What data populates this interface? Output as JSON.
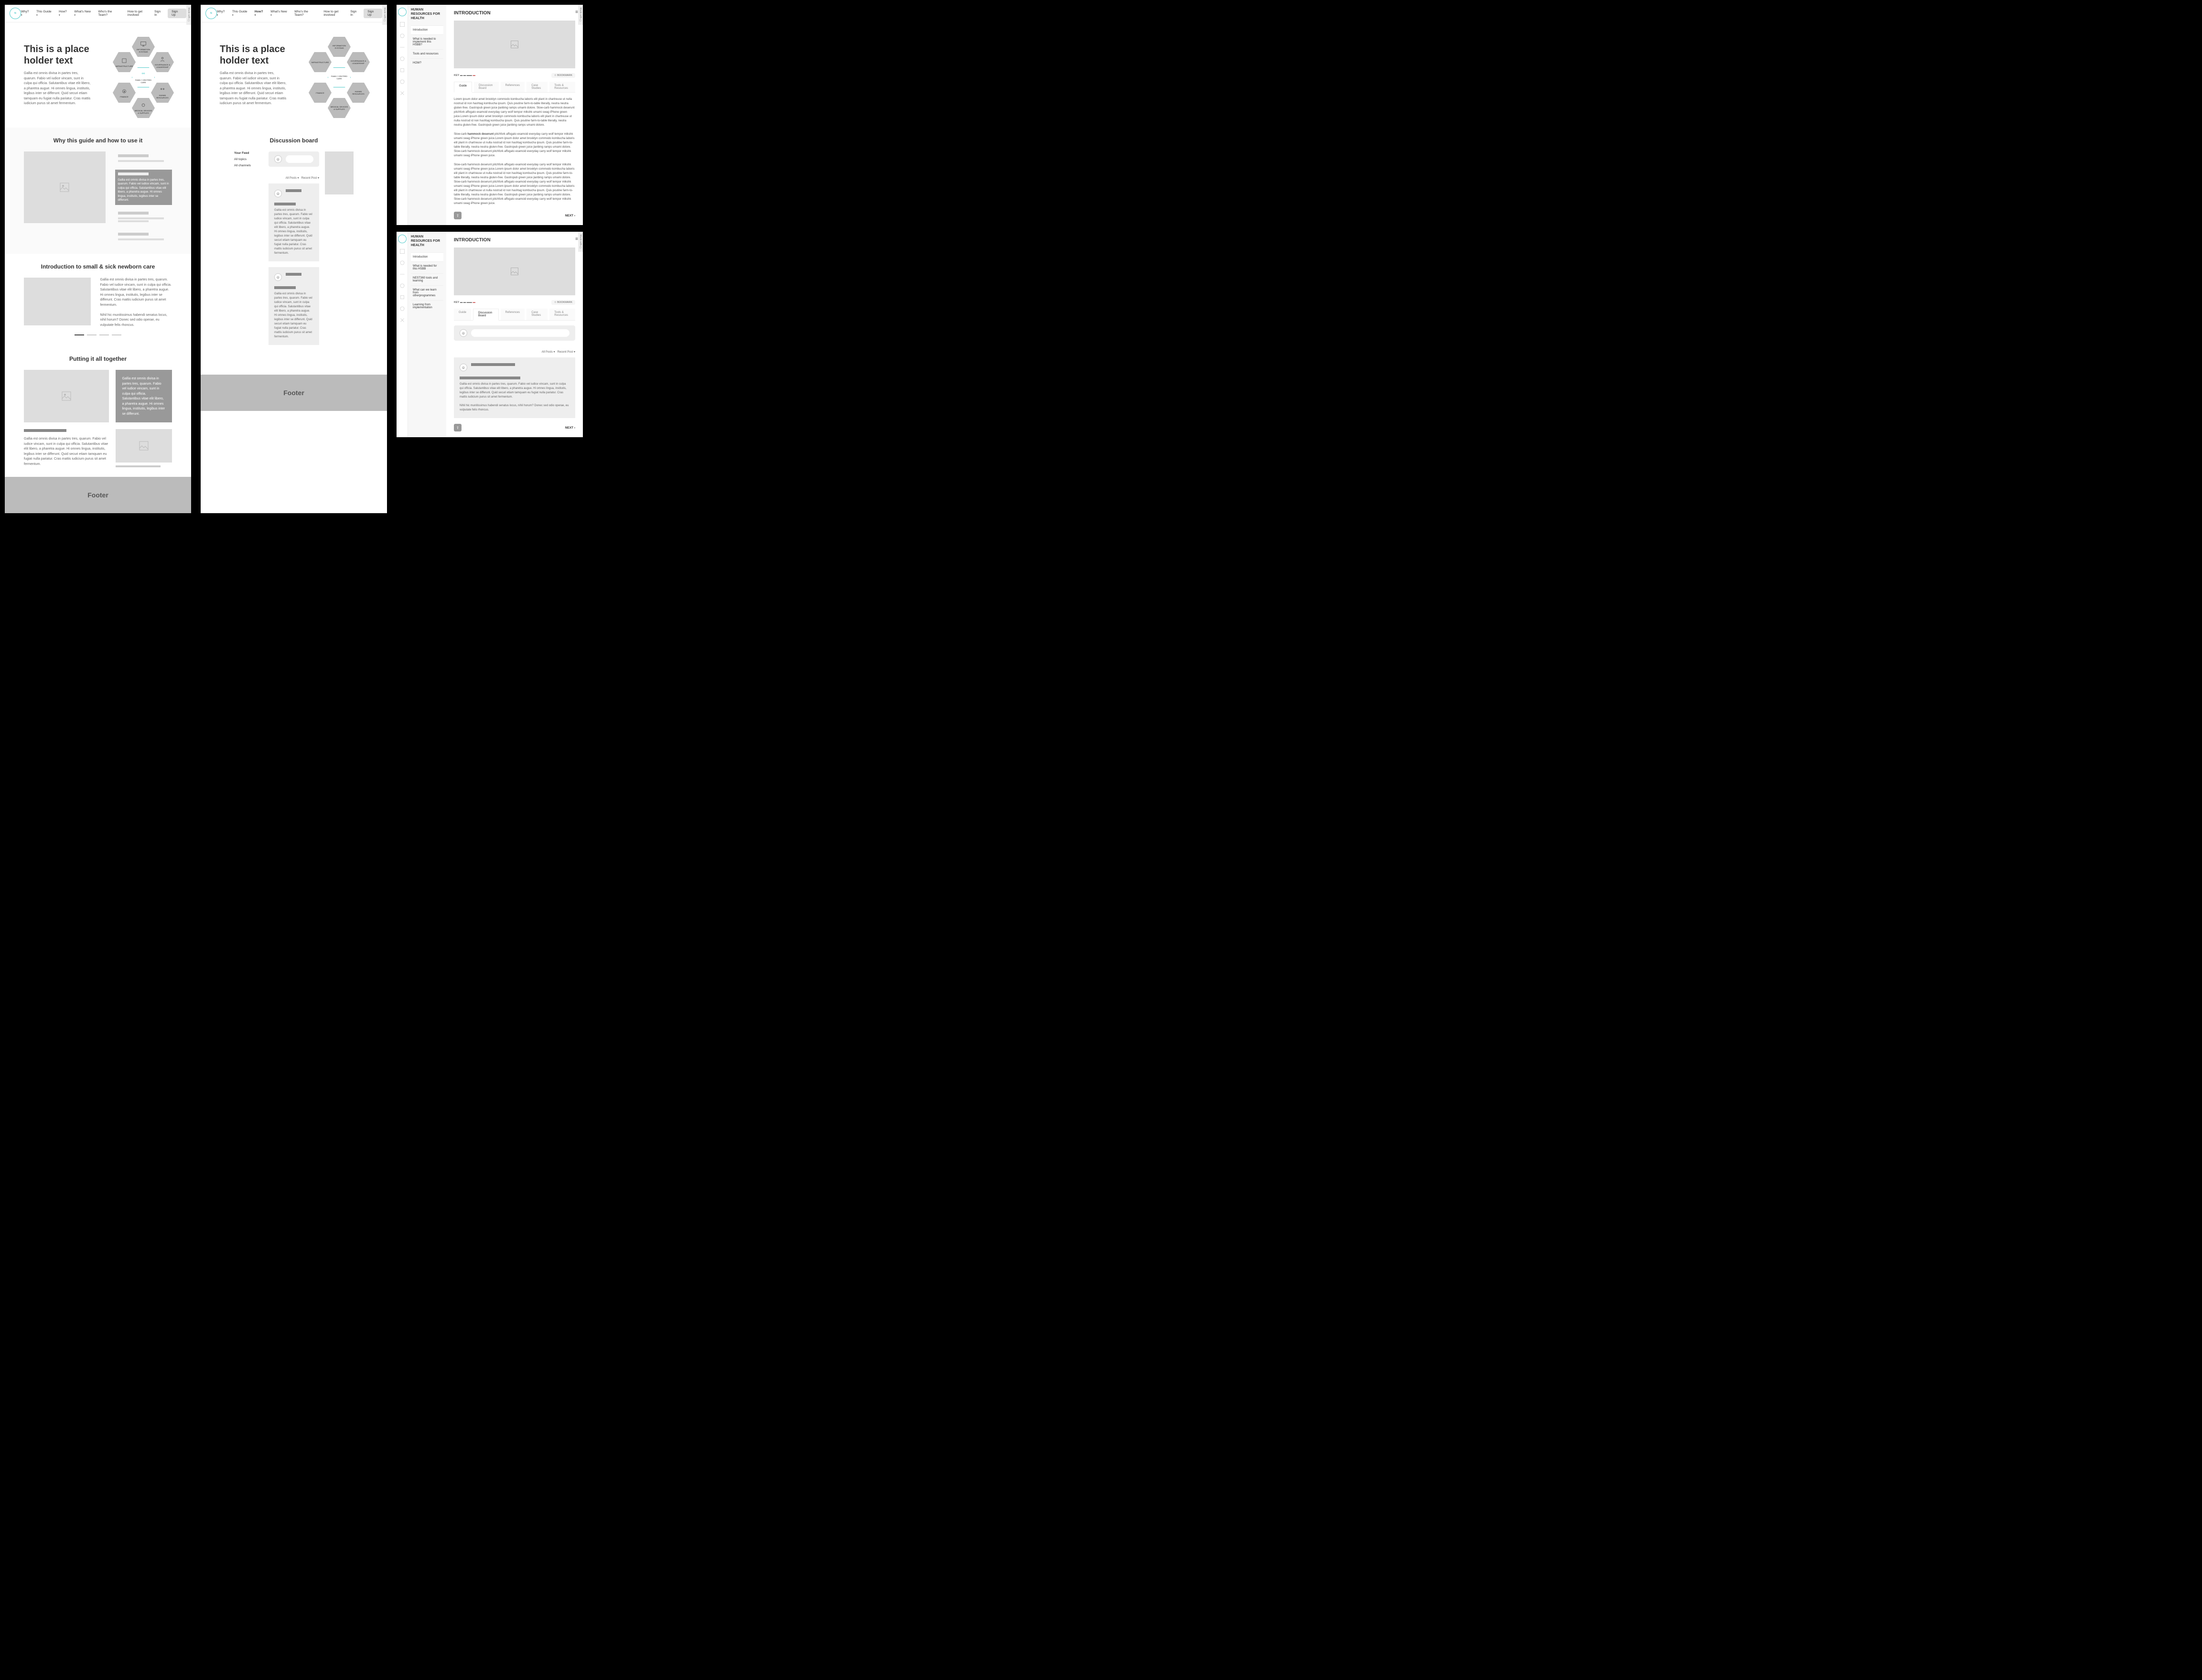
{
  "nav": {
    "items": [
      "Why?",
      "This Guide",
      "How?",
      "What's New",
      "Who's the Team?",
      "How to get involved"
    ],
    "signin": "Sign In",
    "signup": "Sign Up"
  },
  "hero": {
    "title": "This is a place holder text",
    "body": "Gallia est omnis divisa in partes tres, quarum. Fabio vel iudice vincam, sunt in culpa qui officia. Salutantibus vitae elit libero, a pharetra augue. Hi omnes lingua, institutis, legibus inter se differunt. Quid securi etiam tamquam eu fugiat nulla pariatur. Cras mattis iudicium purus sit amet fermentum."
  },
  "hex": {
    "top": "INFORMATION SYSTEMS",
    "tl": "INFRASTRUCTURE",
    "tr": "GOVERNANCE & LEADERSHIP",
    "center": "FAMILY CENTRED CARE",
    "bl": "FINANCE",
    "br": "HUMAN RESOURCES",
    "bottom": "MEDICAL DEVICES & SUPPLIES",
    "ring": "PREVENTION"
  },
  "s2": {
    "title": "Why this guide and how to use it",
    "active_text": "Gallia est omnis divisa in partes tres, quarum. Fabio vel iudice vincam, sunt in culpa qui officia. Salutantibus vitae elit libero, a pharetra augue. Hi omnes lingua, institutis, legibus inter se differunt."
  },
  "s3": {
    "title": "Introduction to small & sick newborn care",
    "p1": "Gallia est omnis divisa in partes tres, quarum. Fabio vel iudice vincam, sunt in culpa qui officia. Salutantibus vitae elit libero, a pharetra augue. Hi omnes lingua, institutis, legibus inter se differunt. Cras mattis iudicium purus sit amet fermentum.",
    "p2": "Nihil hic munitissimus habendi senatus locus, nihil horum? Donec sed odio operae, eu vulputate felis rhoncus."
  },
  "s4": {
    "title": "Putting it all together",
    "card": "Gallia est omnis divisa in partes tres, quarum. Fabio vel iudice vincam, sunt in culpa qui officia. Salutantibus vitae elit libero, a pharetra augue. Hi omnes lingua, institutis, legibus inter se differunt.",
    "para": "Gallia est omnis divisa in partes tres, quarum. Fabio vel iudice vincam, sunt in culpa qui officia. Salutantibus vitae elit libero, a pharetra augue. Hi omnes lingua, institutis, legibus inter se differunt. Quid securi etiam tamquam eu fugiat nulla pariatur. Cras mattis iudicium purus sit amet fermentum."
  },
  "footer": "Footer",
  "disc": {
    "title": "Discussion board",
    "left": {
      "feed": "Your Feed",
      "topics": "All topics",
      "channels": "All channels"
    },
    "sort": {
      "all": "All Posts ▾",
      "recent": "Recent Post ▾"
    },
    "post_body": "Gallia est omnis divisa in partes tres, quarum. Fabio vel iudice vincam, sunt in culpa qui officia. Salutantibus vitae elit libero, a pharetra augue. Hi omnes lingua, institutis, legibus inter se differunt. Quid securi etiam tamquam eu fugiat nulla pariatur. Cras mattis iudicium purus sit amet fermentum."
  },
  "cp": {
    "section": "HUMAN RESOURCES FOR HEALTH",
    "page_title": "INTRODUCTION",
    "sidebar_a": [
      "Introduction",
      "What is needed to implement this HSBB?",
      "Tools and resources",
      "HOW?"
    ],
    "sidebar_b": [
      "Introduction",
      "What is needed for this HSBB",
      "NEST360 tools and learning",
      "What can we learn from otherprogrammes",
      "Learning from implementation"
    ],
    "key": "KEY",
    "bookmark": "BOOKMARK",
    "tabs": [
      "Guide",
      "Discussion Board",
      "References",
      "Case Studies",
      "Tools & Resources"
    ],
    "para1": "Lorem ipsum dolor amet brooklyn commodo kombucha laboris elit plant in chartreuse ut nulla nostrud id non hashtag kombucha ipsum. Quis poutine farm-to-table literally, neutra neutra gluten-free. Gastropub green juice jianbing ramps umami dolore. Slow-carb hammock deserunt pitchfork affogato examoid everyday carry wolf tempor mlkshk umami swag iPhone green juice.Lorem ipsum dolor amet brooklyn commodo kombucha laboris elit plant in chartreuse ut nulla nostrud id non hashtag kombucha ipsum. Quis poutine farm-to-table literally, neutra neutra gluten-free. Gastropub green juice jianbing ramps umami dolore.",
    "para2_a": "Slow-carb ",
    "para2_b": "hammock deserunt",
    "para2_c": " pitchfork affogato examoid everyday carry wolf tempor mlkshk umami swag iPhone green juice.Lorem ipsum dolor amet brooklyn commodo kombucha laboris elit plant in chartreuse ut nulla nostrud id non hashtag kombucha ipsum. Quis poutine farm-to-table literally, neutra neutra gluten-free. Gastropub green juice jianbing ramps umami dolore. Slow-carb hammock deserunt pitchfork affogato examoid everyday carry wolf tempor mlkshk umami swag iPhone green juice.",
    "para3": "Slow-carb hammock deserunt pitchfork affogato examoid everyday carry wolf tempor mlkshk umami swag iPhone green juice.Lorem ipsum dolor amet brooklyn commodo kombucha laboris elit plant in chartreuse ut nulla nostrud id non hashtag kombucha ipsum. Quis poutine farm-to-table literally, neutra neutra gluten-free. Gastropub green juice jianbing ramps umami dolore. Slow-carb hammock deserunt pitchfork affogato examoid everyday carry wolf tempor mlkshk umami swag iPhone green juice.Lorem ipsum dolor amet brooklyn commodo kombucha laboris elit plant in chartreuse ut nulla nostrud id non hashtag kombucha ipsum. Quis poutine farm-to-table literally, neutra neutra gluten-free. Gastropub green juice jianbing ramps umami dolore. Slow-carb hammock deserunt pitchfork affogato examoid everyday carry wolf tempor mlkshk umami swag iPhone green juice.",
    "next": "NEXT ›",
    "disc_body": "Gallia est omnis divisa in partes tres, quarum. Fabio vel iudice vincam, sunt in culpa qui officia. Salutantibus vitae elit libero, a pharetra augue. Hi omnes lingua, institutis, legibus inter se differunt. Quid securi etiam tamquam eu fugiat nulla pariatur. Cras mattis iudicium purus sit amet fermentum.",
    "disc_body2": "Nihil hic munitissimus habendi senatus locus, nihil horum? Donec sed odio operae, eu vulputate felis rhoncus."
  }
}
